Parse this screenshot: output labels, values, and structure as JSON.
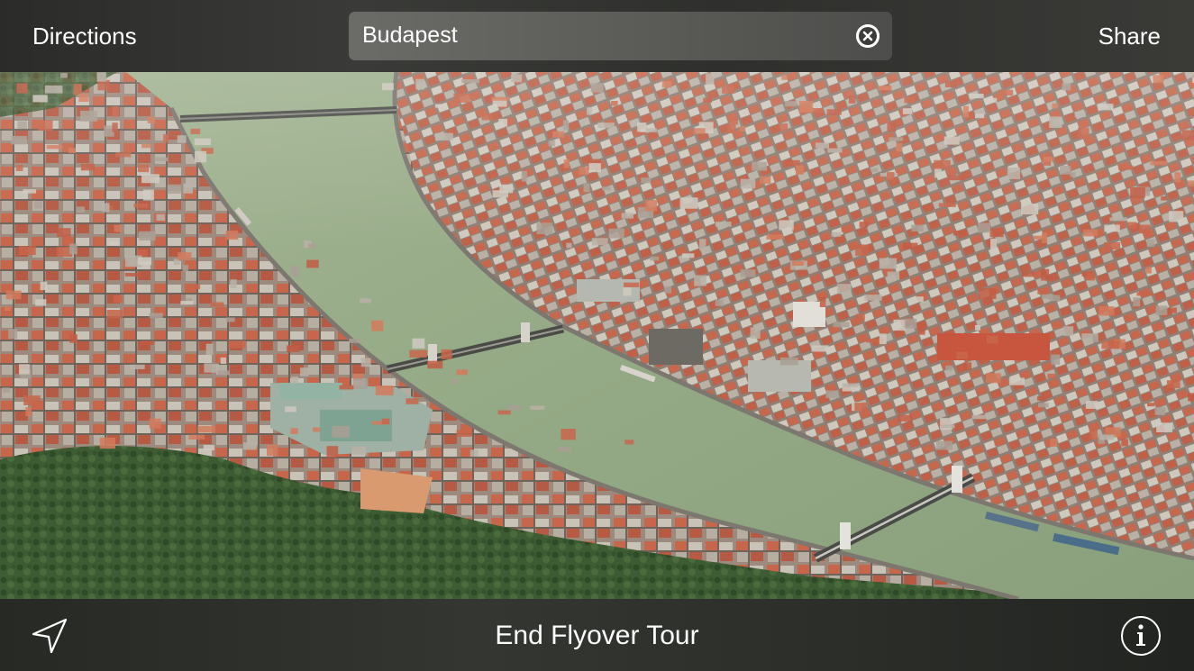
{
  "top_bar": {
    "directions_label": "Directions",
    "share_label": "Share",
    "search": {
      "value": "Budapest",
      "clear_icon": "clear-circle-icon"
    }
  },
  "map": {
    "view": "3D Flyover",
    "location": "Budapest",
    "icons": [
      "location-arrow-icon",
      "info-icon"
    ],
    "colors": {
      "river": "#93a884",
      "buildings_roof": "#c8664b",
      "buildings_wall": "#bdb5aa",
      "greenery": "#3b5a31"
    }
  },
  "bottom_bar": {
    "end_tour_label": "End Flyover Tour",
    "location_icon": "location-arrow-icon",
    "info_icon": "info-icon"
  }
}
